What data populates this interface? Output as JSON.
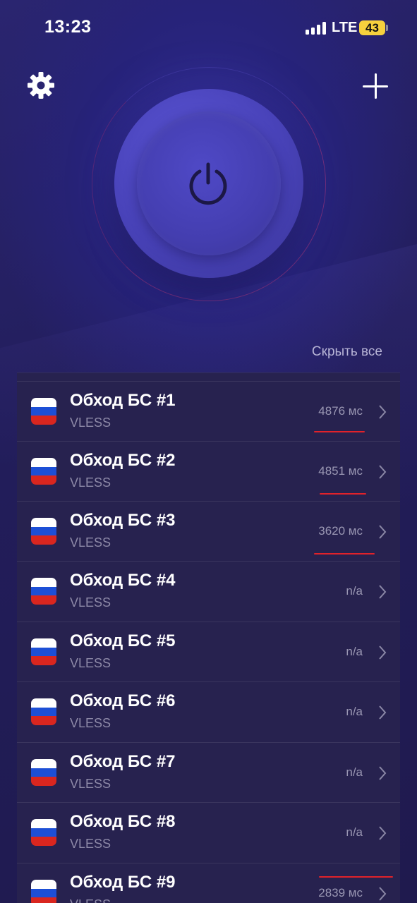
{
  "status_bar": {
    "time": "13:23",
    "network": "LTE",
    "battery": "43"
  },
  "header": {
    "settings_icon": "gear-icon",
    "add_icon": "plus-icon"
  },
  "power_button": {
    "icon": "power-icon"
  },
  "hide_all_label": "Скрыть все",
  "servers": [
    {
      "name": "Обход БС #1",
      "protocol": "VLESS",
      "ping": "4876 мс"
    },
    {
      "name": "Обход БС #2",
      "protocol": "VLESS",
      "ping": "4851 мс"
    },
    {
      "name": "Обход БС #3",
      "protocol": "VLESS",
      "ping": "3620 мс"
    },
    {
      "name": "Обход БС #4",
      "protocol": "VLESS",
      "ping": "n/a"
    },
    {
      "name": "Обход БС #5",
      "protocol": "VLESS",
      "ping": "n/a"
    },
    {
      "name": "Обход БС #6",
      "protocol": "VLESS",
      "ping": "n/a"
    },
    {
      "name": "Обход БС #7",
      "protocol": "VLESS",
      "ping": "n/a"
    },
    {
      "name": "Обход БС #8",
      "protocol": "VLESS",
      "ping": "n/a"
    },
    {
      "name": "Обход БС #9",
      "protocol": "VLESS",
      "ping": "2839 мс"
    }
  ],
  "colors": {
    "background": "#221d5a",
    "list_background": "#27224f",
    "power_button": "#4842b8",
    "annotation_red": "#e0222a",
    "battery_yellow": "#f6d13d"
  }
}
